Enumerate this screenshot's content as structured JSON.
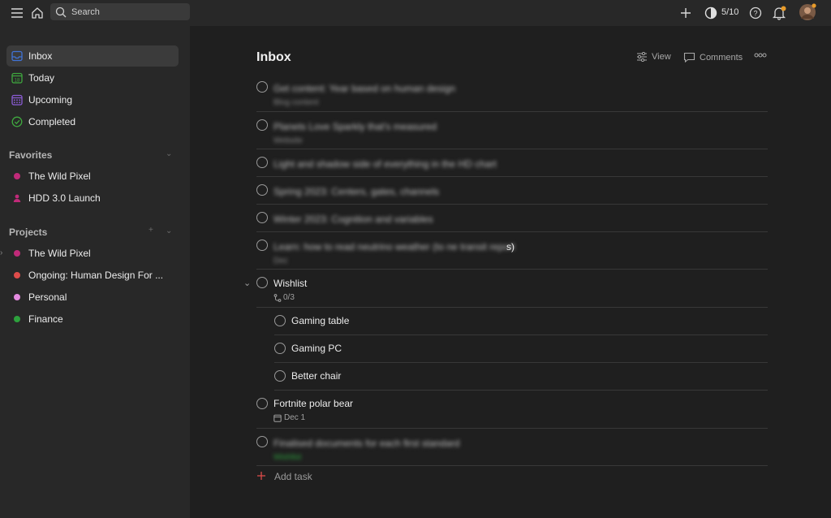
{
  "topbar": {
    "search_placeholder": "Search",
    "karma": "5/10",
    "icons": [
      "menu-icon",
      "home-icon",
      "search-icon",
      "add-icon",
      "productivity-icon",
      "help-icon",
      "bell-icon",
      "avatar"
    ]
  },
  "sidebar": {
    "nav": [
      {
        "label": "Inbox",
        "icon": "inbox-icon",
        "color": "#4073d6"
      },
      {
        "label": "Today",
        "icon": "calendar-today-icon",
        "color": "#3fa83f",
        "day": "18"
      },
      {
        "label": "Upcoming",
        "icon": "calendar-grid-icon",
        "color": "#8c5cd6"
      },
      {
        "label": "Completed",
        "icon": "check-circle-icon",
        "color": "#3fa83f"
      }
    ],
    "favorites_title": "Favorites",
    "favorites": [
      {
        "label": "The Wild Pixel",
        "color": "#c02a79"
      },
      {
        "label": "HDD 3.0 Launch",
        "color": "#c02a79"
      }
    ],
    "projects_title": "Projects",
    "projects": [
      {
        "label": "The Wild Pixel",
        "color": "#c02a79"
      },
      {
        "label": "Ongoing: Human Design For ...",
        "color": "#de4c4a"
      },
      {
        "label": "Personal",
        "color": "#e48be0"
      },
      {
        "label": "Finance",
        "color": "#2da13d"
      }
    ]
  },
  "main": {
    "title": "Inbox",
    "view_label": "View",
    "comments_label": "Comments",
    "tasks": [
      {
        "title": "Get content: Year based on human design",
        "meta": "Blog content",
        "blurred": true
      },
      {
        "title": "Planets Love Sparkly that's measured",
        "meta": "Website",
        "blurred": true
      },
      {
        "title": "Light and shadow side of everything in the HD chart",
        "meta": "",
        "blurred": true
      },
      {
        "title": "Spring 2023: Centers, gates, channels",
        "meta": "",
        "blurred": true
      },
      {
        "title": "Winter 2023: Cognition and variables",
        "meta": "",
        "blurred": true
      },
      {
        "title": "Learn: how to read neutrino weather (to ne transit report",
        "title_end": "s)",
        "meta": "Dec",
        "blurred": true
      },
      {
        "title": "Wishlist",
        "meta": "0/3",
        "blurred": false
      },
      {
        "title": "Gaming table",
        "sub": true
      },
      {
        "title": "Gaming PC",
        "sub": true
      },
      {
        "title": "Better chair",
        "sub": true
      },
      {
        "title": "Fortnite polar bear",
        "meta": "Dec 1",
        "blurred": false
      },
      {
        "title": "Finalised documents for each first standard",
        "meta": "Wishlist",
        "blurred": true
      }
    ],
    "add_task_label": "Add task"
  }
}
